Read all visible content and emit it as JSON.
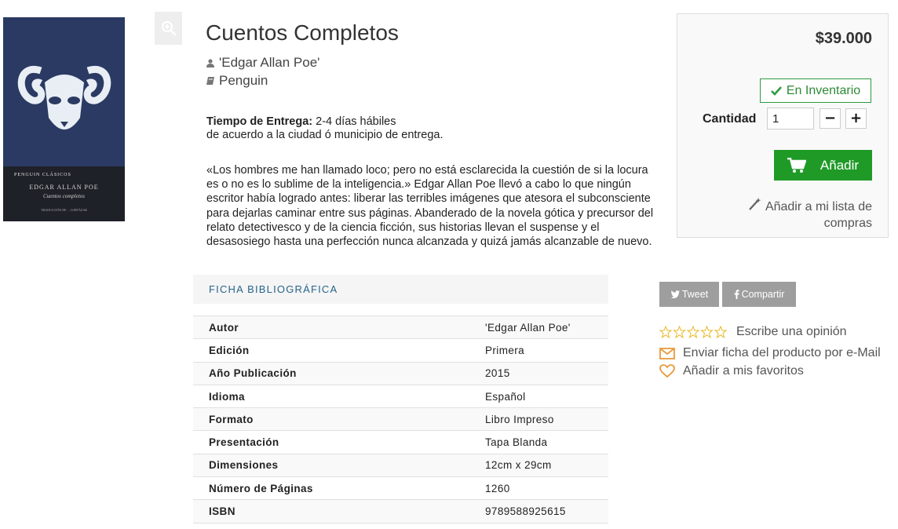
{
  "product": {
    "title": "Cuentos Completos",
    "author": "'Edgar Allan Poe'",
    "publisher": "Penguin"
  },
  "cover": {
    "publisher_line": "PENGUIN CLÁSICOS",
    "author": "EDGAR ALLAN POE",
    "title": "Cuentos completos",
    "credit": "TRADUCCIÓN DE ... CORTÁZAR"
  },
  "delivery": {
    "label": "Tiempo de Entrega:",
    "value": "2-4 días hábiles",
    "note": "de acuerdo a la ciudad ó municipio de entrega."
  },
  "description": "«Los hombres me han llamado loco; pero no está esclarecida la cuestión de si la locura es o no es lo sublime de la inteligencia.» Edgar Allan Poe llevó a cabo lo que ningún escritor había logrado antes: liberar las terribles imágenes que atesora el subconsciente para dejarlas caminar entre sus páginas. Abanderado de la novela gótica y precursor del relato detectivesco y de la ciencia ficción, sus historias llevan el suspense y el desasosiego hasta una perfección nunca alcanzada y quizá jamás alcanzable de nuevo.",
  "ficha": {
    "header": "FICHA BIBLIOGRÁFICA",
    "rows": [
      {
        "key": "Autor",
        "value": "'Edgar Allan Poe'"
      },
      {
        "key": "Edición",
        "value": "Primera"
      },
      {
        "key": "Año Publicación",
        "value": "2015"
      },
      {
        "key": "Idioma",
        "value": "Español"
      },
      {
        "key": "Formato",
        "value": "Libro Impreso"
      },
      {
        "key": "Presentación",
        "value": "Tapa Blanda"
      },
      {
        "key": "Dimensiones",
        "value": "12cm x 29cm"
      },
      {
        "key": "Número de Páginas",
        "value": "1260"
      },
      {
        "key": "ISBN",
        "value": "9789588925615"
      }
    ]
  },
  "buy": {
    "price": "$39.000",
    "stock_label": "En Inventario",
    "quantity_label": "Cantidad",
    "quantity_value": "1",
    "minus": "−",
    "plus": "+",
    "add_label": "Añadir",
    "wishlist_label": "Añadir a mi lista de compras"
  },
  "social": {
    "tweet": "Tweet",
    "share": "Compartir"
  },
  "links": {
    "review": "Escribe una opinión",
    "email": "Enviar ficha del producto por e-Mail",
    "favorites": "Añadir a mis favoritos"
  },
  "colors": {
    "accent_green": "#1f9a27",
    "ficha_blue": "#26648a",
    "star_gold": "#e8b923",
    "icon_orange": "#e89a3c"
  },
  "icons": {
    "zoom": "zoom-in-icon",
    "author": "user-icon",
    "publisher": "book-icon",
    "stock": "check-icon",
    "cart": "cart-icon",
    "wishlist": "magic-wand-icon",
    "tweet": "twitter-icon",
    "share": "facebook-icon",
    "review": "star-icon",
    "email": "envelope-icon",
    "favorites": "heart-icon"
  }
}
